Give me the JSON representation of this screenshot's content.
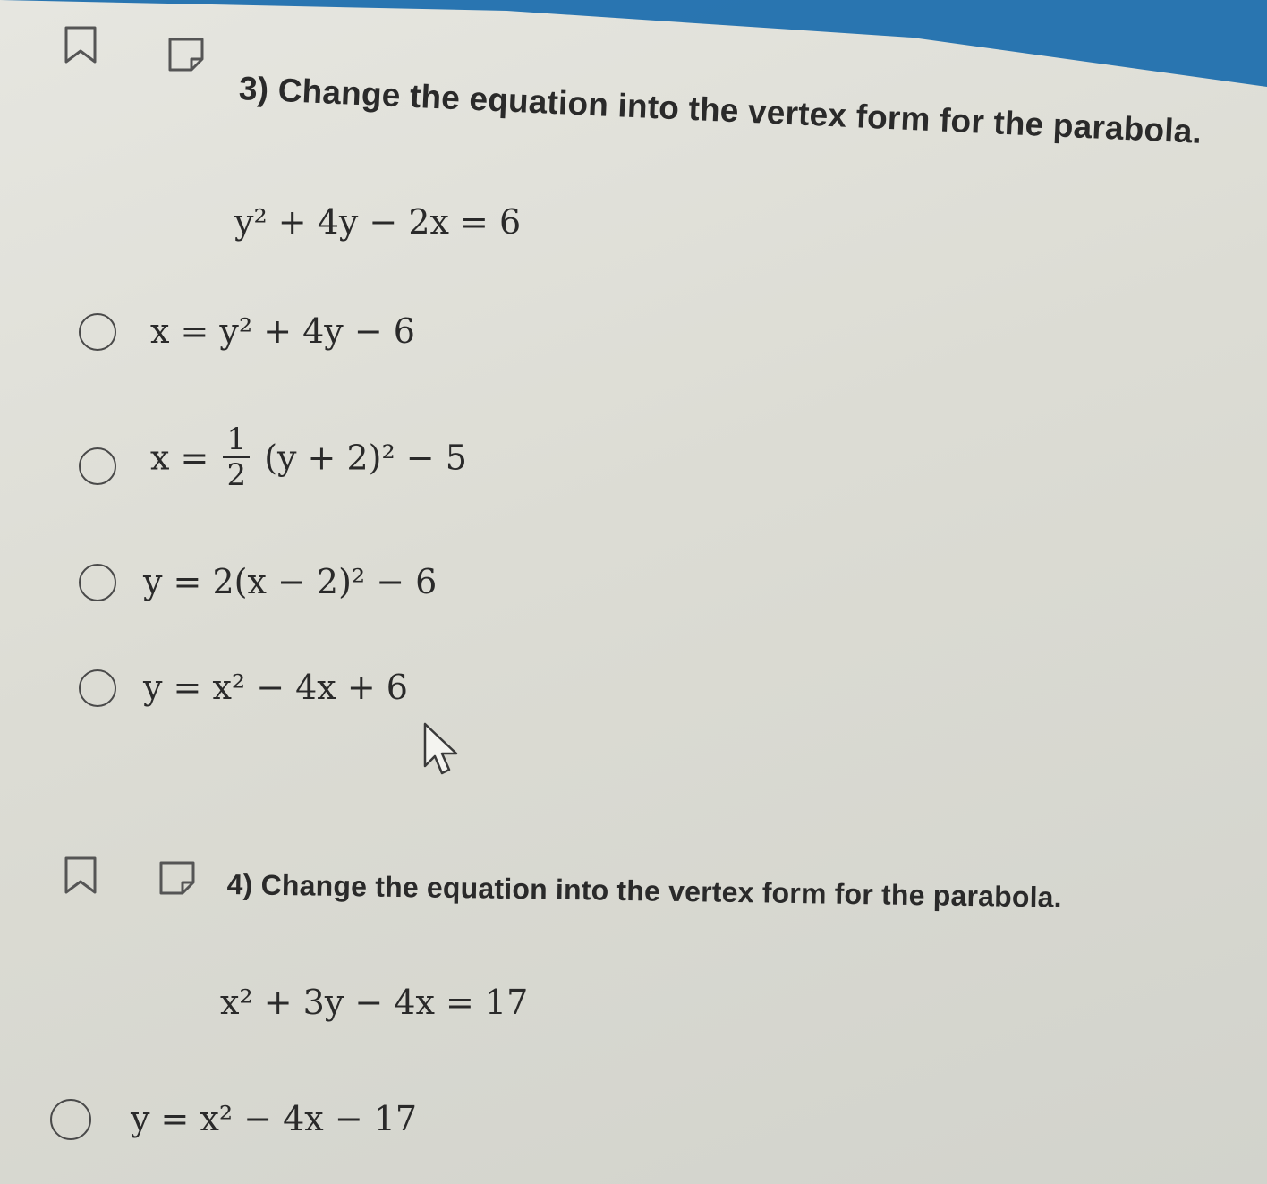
{
  "questions": [
    {
      "title": "3) Change the equation into the vertex form for the parabola.",
      "equation": "y² + 4y − 2x = 6",
      "choices": [
        {
          "text": "x = y² + 4y − 6"
        },
        {
          "prefix": "x =",
          "numerator": "1",
          "denominator": "2",
          "suffix": "(y + 2)² − 5"
        },
        {
          "text": "y = 2(x − 2)² − 6"
        },
        {
          "text": "y = x² − 4x + 6"
        }
      ]
    },
    {
      "title": "4) Change the equation into the vertex form for the parabola.",
      "equation": "x² + 3y − 4x = 17",
      "choices": [
        {
          "text": "y = x² − 4x − 17"
        }
      ]
    }
  ],
  "icons": {
    "bookmark": "bookmark-icon",
    "note": "note-icon",
    "cursor": "mouse-pointer-icon"
  },
  "colors": {
    "top_strip": "#1f6fae",
    "text": "#2a2a2a",
    "radio_border": "#4a4a4a"
  }
}
